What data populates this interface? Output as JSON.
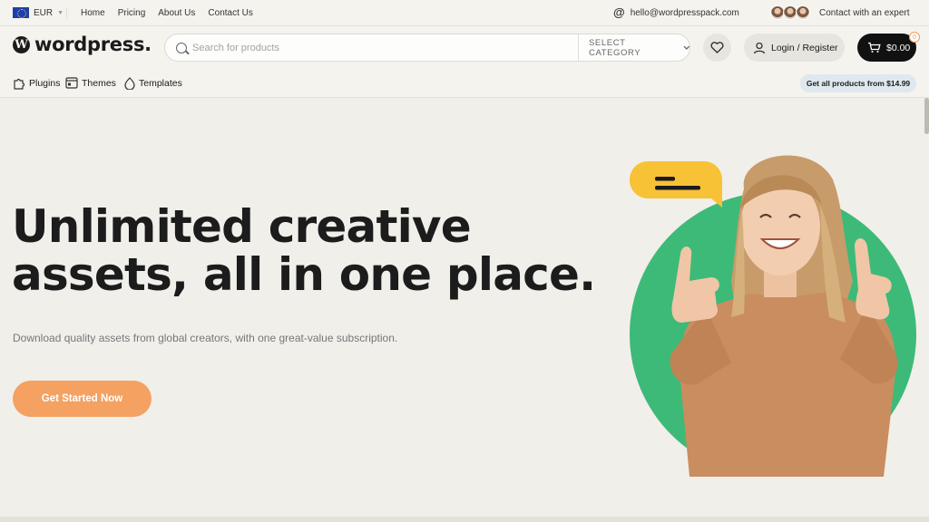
{
  "topbar": {
    "currency": "EUR",
    "nav": [
      "Home",
      "Pricing",
      "About Us",
      "Contact Us"
    ],
    "email": "hello@wordpresspack.com",
    "contact_expert": "Contact with an expert"
  },
  "header": {
    "brand": "wordpress.",
    "search_placeholder": "Search for products",
    "category_label": "SELECT CATEGORY",
    "login_label": "Login / Register",
    "cart_total": "$0.00",
    "cart_count": "0"
  },
  "catnav": {
    "items": [
      "Plugins",
      "Themes",
      "Templates"
    ],
    "promo": "Get all products from $14.99"
  },
  "hero": {
    "title_line1": "Unlimited creative",
    "title_line2": "assets, all in one place.",
    "subtitle": "Download quality assets from global creators, with one great-value subscription.",
    "cta_label": "Get Started Now"
  },
  "colors": {
    "accent_orange": "#f4a162",
    "hero_green": "#3dba78",
    "bubble_yellow": "#f7c235",
    "cart_black": "#111111",
    "sweater": "#c98d5f"
  },
  "icons": [
    "eu-flag-icon",
    "at-icon",
    "search-icon",
    "chevron-down-icon",
    "heart-icon",
    "user-icon",
    "cart-icon",
    "puzzle-icon",
    "theme-icon",
    "template-icon",
    "chat-bubble-icon"
  ]
}
